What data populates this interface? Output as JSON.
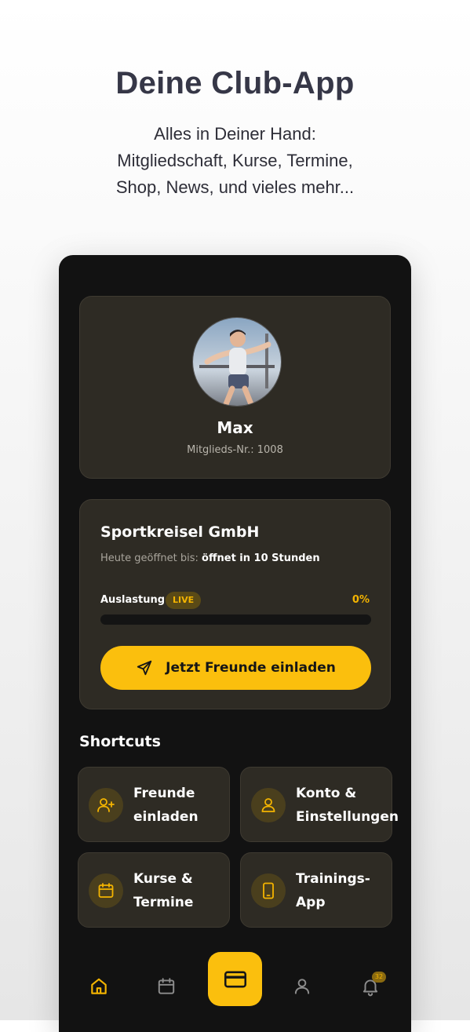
{
  "hero": {
    "title": "Deine Club-App",
    "subtitle_lines": [
      "Alles in Deiner Hand:",
      "Mitgliedschaft, Kurse, Termine,",
      "Shop, News, und vieles mehr..."
    ]
  },
  "profile": {
    "name": "Max",
    "member_number": "Mitglieds-Nr.: 1008",
    "avatar": "member-photo"
  },
  "club": {
    "name": "Sportkreisel GmbH",
    "open_label": "Heute geöffnet bis:",
    "open_value": "öffnet in 10 Stunden",
    "occupancy_label": "Auslastung",
    "live_badge": "LIVE",
    "occupancy_percent_text": "0%",
    "occupancy_fraction": 0,
    "invite_button": "Jetzt Freunde einladen",
    "invite_icon": "send-icon"
  },
  "shortcuts": {
    "heading": "Shortcuts",
    "items": [
      {
        "line1": "Freunde",
        "line2": "einladen",
        "icon": "user-plus-icon"
      },
      {
        "line1": "Konto &",
        "line2": "Einstellungen",
        "icon": "user-icon"
      },
      {
        "line1": "Kurse &",
        "line2": "Termine",
        "icon": "calendar-icon"
      },
      {
        "line1": "Trainings-",
        "line2": "App",
        "icon": "smartphone-icon"
      }
    ]
  },
  "bottom_nav": {
    "items": [
      "home-icon",
      "calendar-icon",
      "card-icon",
      "user-icon",
      "bell-icon"
    ],
    "notification_count": "32"
  },
  "colors": {
    "accent": "#fbbf0d",
    "phone_background": "#121212",
    "card_background": "#2e2b24",
    "hero_text": "#363747"
  }
}
